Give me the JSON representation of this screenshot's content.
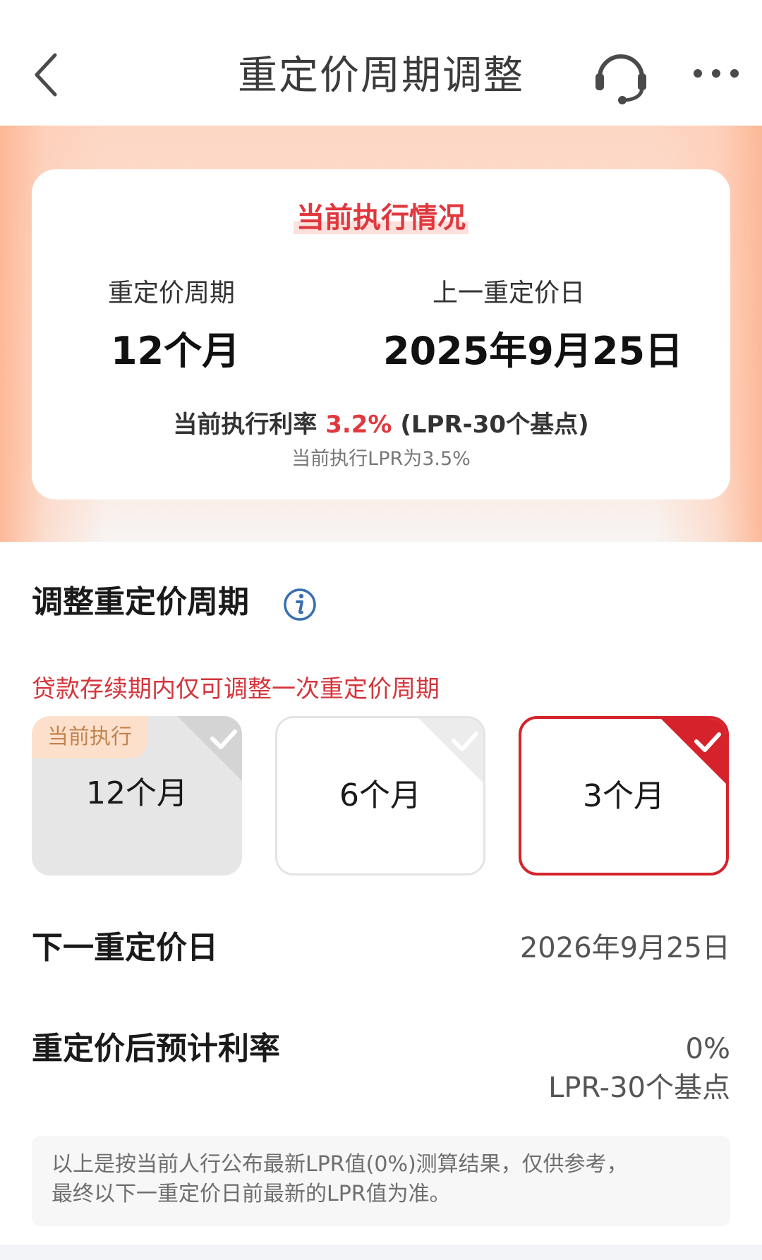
{
  "header": {
    "title": "重定价周期调整",
    "back_icon": "chevron-left-icon",
    "support_icon": "headset-icon",
    "more_icon": "more-dots-icon"
  },
  "status": {
    "title": "当前执行情况",
    "cycle_label": "重定价周期",
    "cycle_value": "12个月",
    "date_label": "上一重定价日",
    "date_value": "2025年9月25日",
    "rate_prefix": "当前执行利率",
    "rate_value": "3.2%",
    "rate_suffix": "(LPR-30个基点)",
    "lpr_note": "当前执行LPR为3.5%"
  },
  "adjust": {
    "title": "调整重定价周期",
    "info_icon": "info-icon",
    "warning": "贷款存续期内仅可调整一次重定价周期",
    "current_tag": "当前执行",
    "options": [
      {
        "label": "12个月",
        "state": "current"
      },
      {
        "label": "6个月",
        "state": "unselected"
      },
      {
        "label": "3个月",
        "state": "selected"
      }
    ]
  },
  "next_date": {
    "label": "下一重定价日",
    "value": "2026年9月25日"
  },
  "expected_rate": {
    "label": "重定价后预计利率",
    "value": "0%",
    "sub": "LPR-30个基点"
  },
  "note": {
    "line1": "以上是按当前人行公布最新LPR值(0%)测算结果，仅供参考，",
    "line2": "最终以下一重定价日前最新的LPR值为准。"
  },
  "colors": {
    "accent_red": "#d6232b",
    "title_red": "#e0383e",
    "tag_bg": "#fde0cc",
    "tag_text": "#c2834f",
    "info_blue": "#3a6fb0"
  }
}
